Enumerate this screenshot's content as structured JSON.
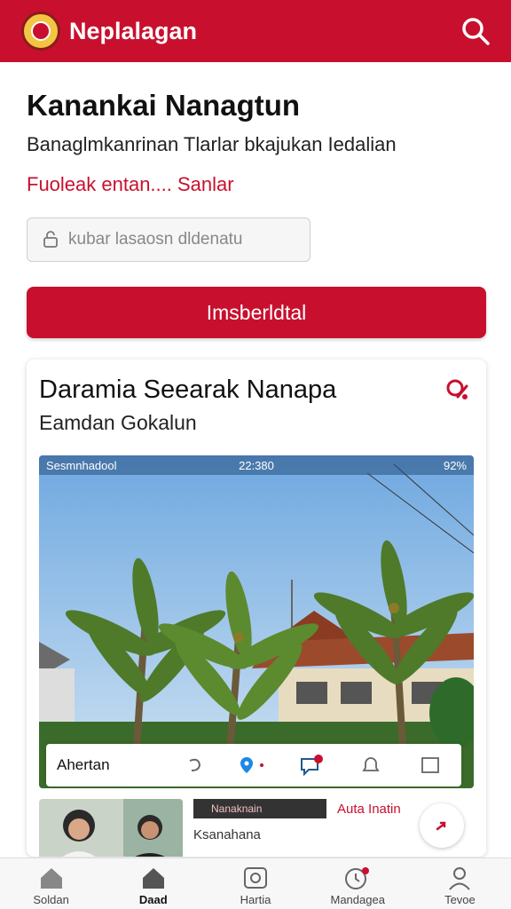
{
  "header": {
    "app_title": "Neplalagan",
    "brand_color": "#c8102e"
  },
  "top": {
    "title": "Kanankai Nanagtun",
    "subtitle": "Banaglmkanrinan Tlarlar bkajukan Iedalian",
    "link_text": "Fuoleak entan.... Sanlar",
    "input_placeholder": "kubar lasaosn dldenatu",
    "primary_button": "Imsberldtal"
  },
  "card": {
    "title": "Daramia Seearak Nanapa",
    "subtitle": "Eamdan Gokalun",
    "status_bar": {
      "carrier": "Sesmnhadool",
      "time": "22:380",
      "battery": "92%"
    },
    "action_bar": {
      "label": "Ahertan"
    },
    "tag_label": "Nanaknain",
    "tag_link": "Auta Inatin",
    "tag_sub": "Ksanahana"
  },
  "bottom_nav": [
    {
      "label": "Soldan",
      "icon": "home-outline-icon"
    },
    {
      "label": "Daad",
      "icon": "home-filled-icon"
    },
    {
      "label": "Hartia",
      "icon": "camera-icon"
    },
    {
      "label": "Mandagea",
      "icon": "clock-notification-icon"
    },
    {
      "label": "Tevoe",
      "icon": "profile-icon"
    }
  ]
}
